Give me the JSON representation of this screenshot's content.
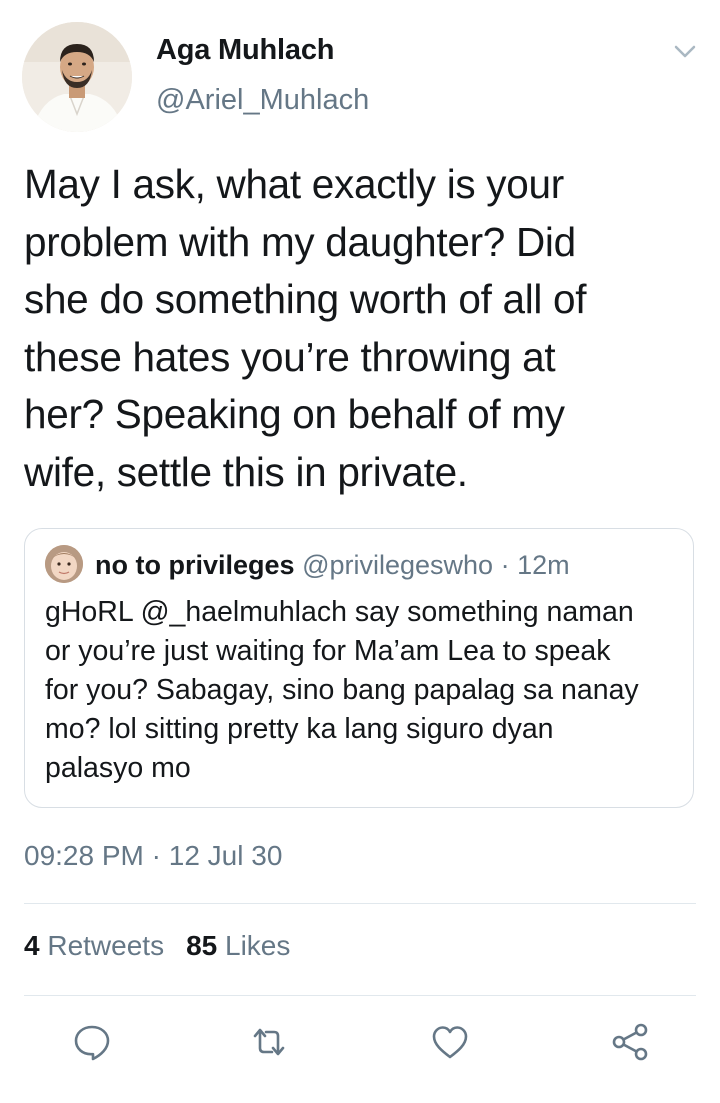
{
  "author": {
    "name": "Aga Muhlach",
    "handle": "@Ariel_Muhlach",
    "avatar_icon": "profile-photo"
  },
  "tweet": {
    "lines": [
      "May I ask, what exactly is your",
      "problem with my daughter? Did",
      "she do something worth of all of",
      "these hates you’re throwing at",
      "her? Speaking on behalf of my",
      "wife, settle this in private."
    ]
  },
  "quoted": {
    "name": "no to privileges",
    "handle": "@privilegeswho",
    "separator": "·",
    "time": "12m",
    "lines": [
      "gHoRL @_haelmuhlach say something naman",
      "or you’re just waiting for Ma’am Lea to speak",
      "for you? Sabagay, sino bang papalag sa nanay",
      "mo? lol sitting pretty ka lang siguro dyan",
      "palasyo mo"
    ]
  },
  "meta": {
    "time": "09:28 PM",
    "separator": "·",
    "date": "12 Jul 30"
  },
  "stats": {
    "retweets_count": "4",
    "retweets_label": "Retweets",
    "likes_count": "85",
    "likes_label": "Likes"
  },
  "actions": [
    "reply-icon",
    "retweet-icon",
    "like-icon",
    "share-icon"
  ],
  "colors": {
    "text": "#14171a",
    "secondary": "#657786",
    "border": "#d8dee4",
    "divider": "#e1e8ed"
  }
}
